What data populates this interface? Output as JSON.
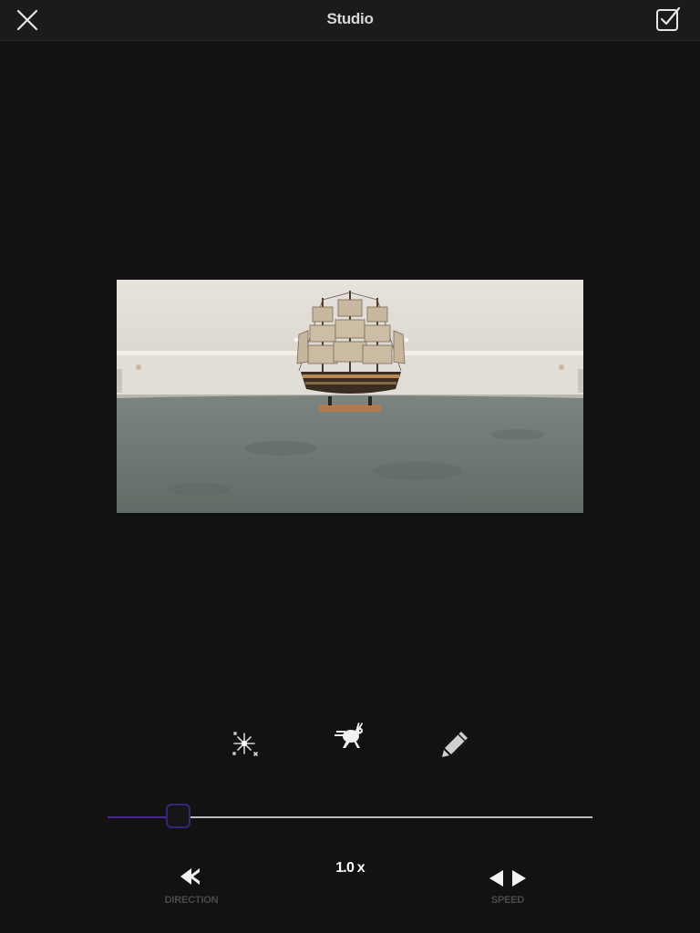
{
  "navbar": {
    "title": "Studio",
    "close_icon": "close-icon",
    "done_icon": "checkbox-edit-icon"
  },
  "preview": {
    "description_icon": "photo-preview"
  },
  "tools": [
    {
      "icon": "sparkle-icon"
    },
    {
      "icon": "running-rabbit-icon"
    },
    {
      "icon": "pencil-icon"
    }
  ],
  "slider": {
    "value_fraction": 0.145,
    "accent_color": "#4a2a86"
  },
  "speed": {
    "value": "1.0 x"
  },
  "controls": {
    "direction_label": "DIRECTION",
    "speed_label": "SPEED"
  }
}
